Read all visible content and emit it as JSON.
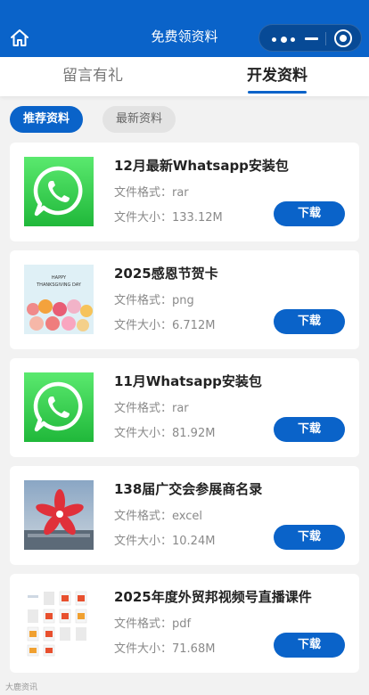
{
  "header": {
    "title": "免费领资料"
  },
  "tabs": [
    {
      "label": "留言有礼",
      "active": false
    },
    {
      "label": "开发资料",
      "active": true
    }
  ],
  "subtabs": [
    {
      "label": "推荐资料",
      "active": true
    },
    {
      "label": "最新资料",
      "active": false
    }
  ],
  "items": [
    {
      "title": "12月最新Whatsapp安装包",
      "format": "文件格式：rar",
      "size": "文件大小：133.12M",
      "button": "下载",
      "thumb": "whatsapp-logo"
    },
    {
      "title": "2025感恩节贺卡",
      "format": "文件格式：png",
      "size": "文件大小：6.712M",
      "button": "下载",
      "thumb": "thanksgiving-card",
      "thumb_text": [
        "HAPPY",
        "THANKSGIVING DAY"
      ]
    },
    {
      "title": "11月Whatsapp安装包",
      "format": "文件格式：rar",
      "size": "文件大小：81.92M",
      "button": "下载",
      "thumb": "whatsapp-logo"
    },
    {
      "title": "138届广交会参展商名录",
      "format": "文件格式：excel",
      "size": "文件大小：10.24M",
      "button": "下载",
      "thumb": "canton-fair-photo"
    },
    {
      "title": "2025年度外贸邦视频号直播课件",
      "format": "文件格式：pdf",
      "size": "文件大小：71.68M",
      "button": "下载",
      "thumb": "pdf-file-grid"
    }
  ],
  "watermark": "大鹿资讯",
  "colors": {
    "primary": "#0a63c9",
    "whatsapp_green": "#25d366"
  }
}
